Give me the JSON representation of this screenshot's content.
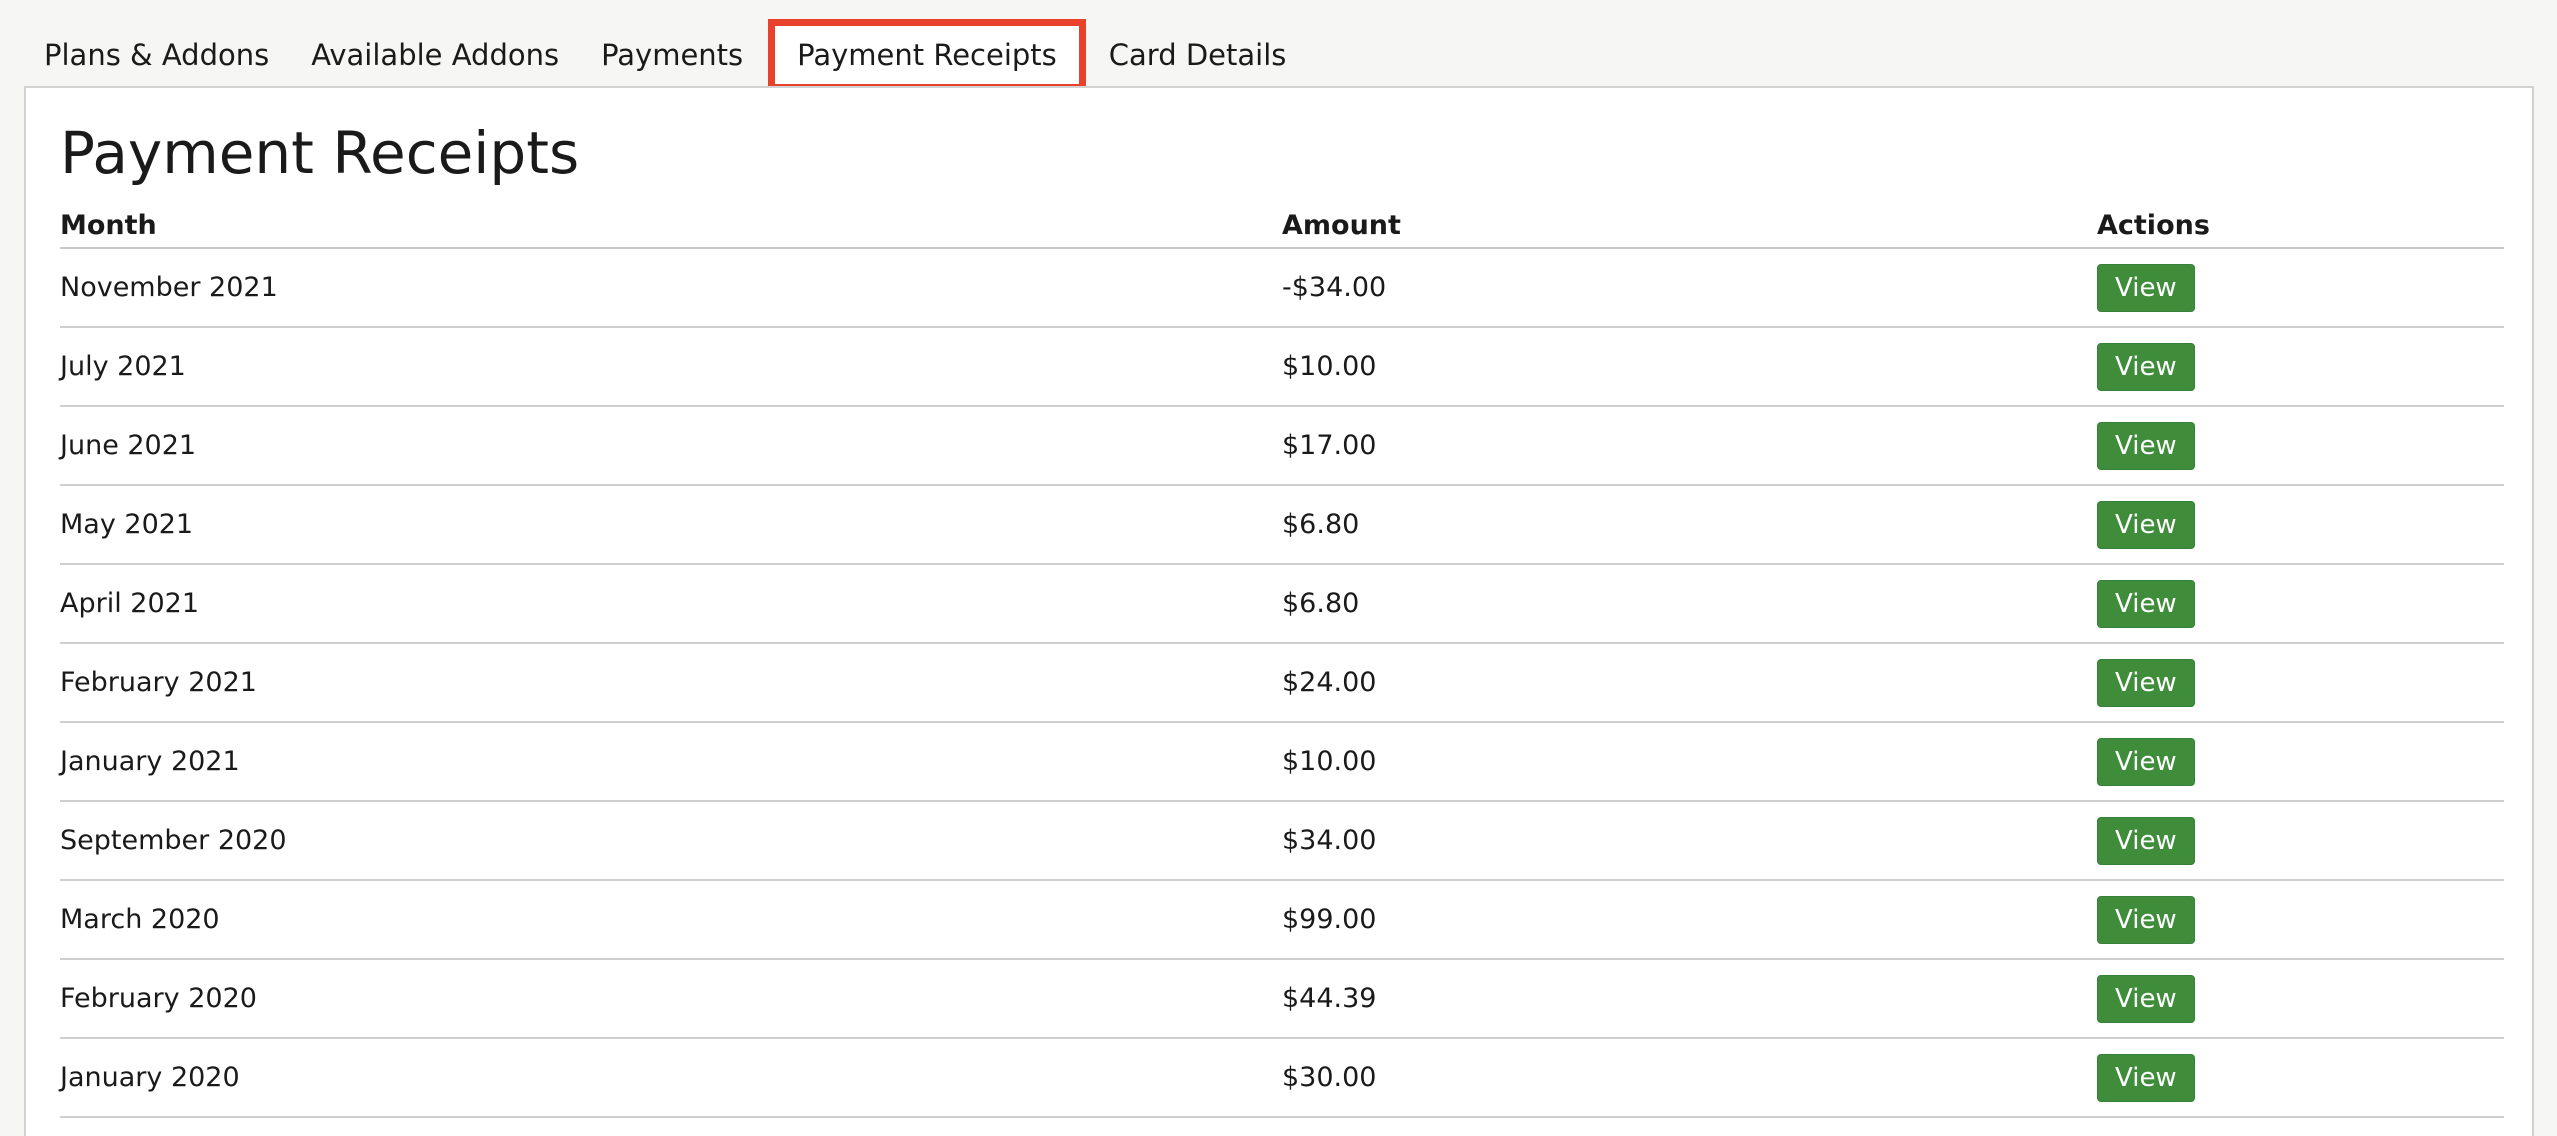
{
  "tabs": [
    {
      "label": "Plans & Addons",
      "active": false
    },
    {
      "label": "Available Addons",
      "active": false
    },
    {
      "label": "Payments",
      "active": false
    },
    {
      "label": "Payment Receipts",
      "active": true
    },
    {
      "label": "Card Details",
      "active": false
    }
  ],
  "page": {
    "title": "Payment Receipts"
  },
  "table": {
    "headers": {
      "month": "Month",
      "amount": "Amount",
      "actions": "Actions"
    },
    "rows": [
      {
        "month": "November 2021",
        "amount": "-$34.00",
        "action": "View"
      },
      {
        "month": "July 2021",
        "amount": "$10.00",
        "action": "View"
      },
      {
        "month": "June 2021",
        "amount": "$17.00",
        "action": "View"
      },
      {
        "month": "May 2021",
        "amount": "$6.80",
        "action": "View"
      },
      {
        "month": "April 2021",
        "amount": "$6.80",
        "action": "View"
      },
      {
        "month": "February 2021",
        "amount": "$24.00",
        "action": "View"
      },
      {
        "month": "January 2021",
        "amount": "$10.00",
        "action": "View"
      },
      {
        "month": "September 2020",
        "amount": "$34.00",
        "action": "View"
      },
      {
        "month": "March 2020",
        "amount": "$99.00",
        "action": "View"
      },
      {
        "month": "February 2020",
        "amount": "$44.39",
        "action": "View"
      },
      {
        "month": "January 2020",
        "amount": "$30.00",
        "action": "View"
      }
    ]
  },
  "colors": {
    "highlight": "#e8412c",
    "button": "#3f8d3a"
  }
}
